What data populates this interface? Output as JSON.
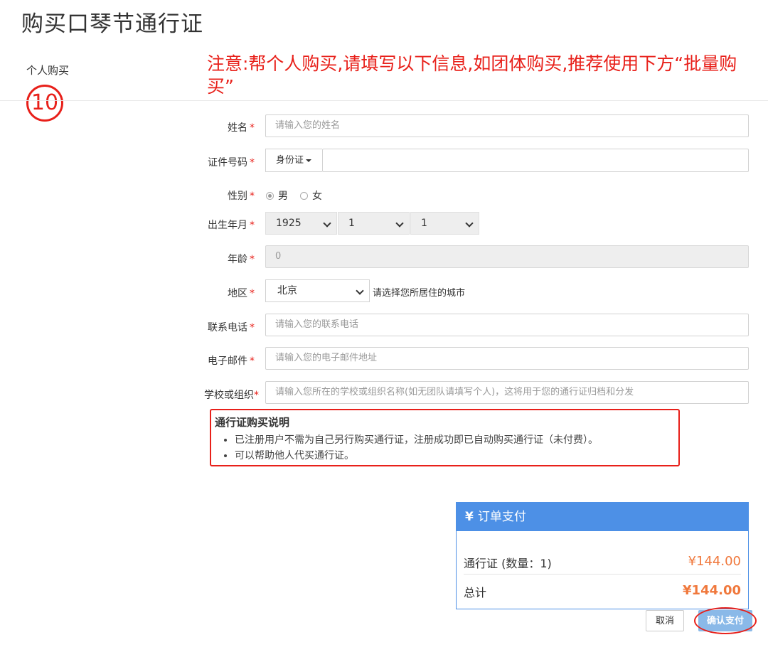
{
  "page": {
    "title": "购买口琴节通行证",
    "section_label": "个人购买",
    "step_marker": "⑩",
    "notice": "注意:帮个人购买,请填写以下信息,如团体购买,推荐使用下方“批量购买”"
  },
  "form": {
    "required_mark": "*",
    "name": {
      "label": "姓名",
      "placeholder": "请输入您的姓名"
    },
    "id_number": {
      "label": "证件号码",
      "type_value": "身份证",
      "value": ""
    },
    "gender": {
      "label": "性别",
      "options": [
        "男",
        "女"
      ],
      "selected": "男"
    },
    "birth": {
      "label": "出生年月",
      "year": "1925",
      "month": "1",
      "day": "1"
    },
    "age": {
      "label": "年龄",
      "value": "0"
    },
    "region": {
      "label": "地区",
      "value": "北京",
      "hint": "请选择您所居住的城市"
    },
    "phone": {
      "label": "联系电话",
      "placeholder": "请输入您的联系电话"
    },
    "email": {
      "label": "电子邮件",
      "placeholder": "请输入您的电子邮件地址"
    },
    "school": {
      "label": "学校或组织",
      "placeholder": "请输入您所在的学校或组织名称(如无团队请填写个人)，这将用于您的通行证归档和分发"
    }
  },
  "pass_info": {
    "title": "通行证购买说明",
    "items": [
      "已注册用户不需为自己另行购买通行证，注册成功即已自动购买通行证（未付费）。",
      "可以帮助他人代买通行证。"
    ]
  },
  "order": {
    "header": "订单支付",
    "currency_icon": "¥",
    "item_label": "通行证 (数量：1)",
    "item_amount": "¥144.00",
    "total_label": "总计",
    "total_amount": "¥144.00"
  },
  "buttons": {
    "cancel": "取消",
    "confirm": "确认支付"
  },
  "colors": {
    "accent_blue": "#4d90e6",
    "annotation_red": "#e8201a",
    "price_orange": "#f0783c"
  }
}
